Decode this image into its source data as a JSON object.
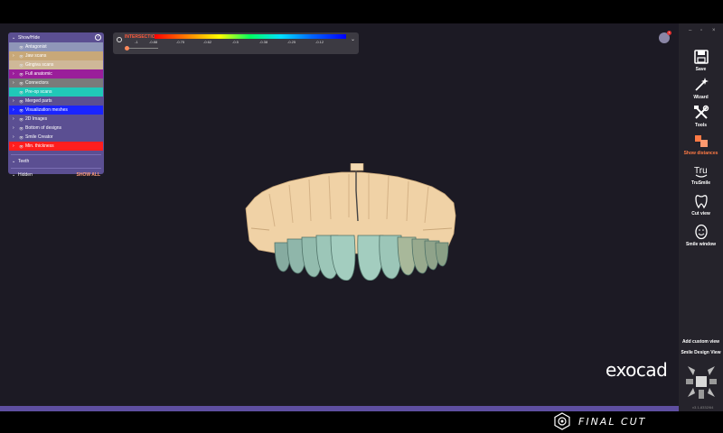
{
  "show_hide": {
    "title": "Show/Hide",
    "items": [
      {
        "label": "Antagonist",
        "color": "#8f96b8",
        "expand": false
      },
      {
        "label": "Jaw scans",
        "color": "#c8a878",
        "expand": true
      },
      {
        "label": "Gingiva scans",
        "color": "#cfb898",
        "expand": false
      },
      {
        "label": "Full anatomic",
        "color": "#9a1e9a",
        "expand": true
      },
      {
        "label": "Connectors",
        "color": "#7a7a7a",
        "expand": true
      },
      {
        "label": "Pre-op scans",
        "color": "#20c8b8",
        "expand": false
      },
      {
        "label": "Merged parts",
        "color": "#5b4f92",
        "expand": true
      },
      {
        "label": "Visualization meshes",
        "color": "#1a24ff",
        "expand": true
      },
      {
        "label": "2D Images",
        "color": "#5b4f92",
        "expand": true
      },
      {
        "label": "Bottom of designs",
        "color": "#5b4f92",
        "expand": true
      },
      {
        "label": "Smile Creator",
        "color": "#5b4f92",
        "expand": true
      },
      {
        "label": "Min. thickness",
        "color": "#ff1e1e",
        "expand": true
      }
    ],
    "teeth_label": "Teeth",
    "hidden_label": "Hidden",
    "show_all_label": "SHOW ALL"
  },
  "scale": {
    "label": "INTERSECTION",
    "ticks": [
      "-1",
      "-0.88",
      "-0.75",
      "-0.62",
      "-0.5",
      "-0.38",
      "-0.25",
      "-0.12"
    ]
  },
  "notification": {
    "count": "1"
  },
  "logo": "exocad",
  "toolbar": {
    "window_controls": [
      "–",
      "▫",
      "×"
    ],
    "tools": [
      {
        "label": "Save",
        "icon": "save-icon"
      },
      {
        "label": "Wizard",
        "icon": "wizard-icon"
      },
      {
        "label": "Tools",
        "icon": "tools-icon"
      },
      {
        "label": "Show distances",
        "icon": "show-distances-icon"
      },
      {
        "label": "TruSmile",
        "icon": "trusmile-icon"
      },
      {
        "label": "Cut view",
        "icon": "cut-view-icon"
      },
      {
        "label": "Smile window",
        "icon": "smile-window-icon"
      }
    ],
    "add_custom_view": "Add custom view",
    "smile_design_view": "Smile Design View",
    "version": "v3.1-8332/64"
  },
  "brand": {
    "final_cut": "FINAL CUT"
  },
  "colors": {
    "accent": "#ff7a45",
    "panel": "#5b4f92"
  }
}
